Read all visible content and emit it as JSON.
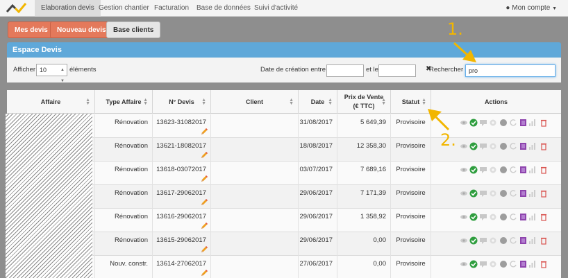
{
  "nav": {
    "items": [
      "Elaboration devis",
      "Gestion chantier",
      "Facturation",
      "Base de données",
      "Suivi d'activité"
    ],
    "account": "Mon compte"
  },
  "buttons": {
    "mes_devis": "Mes devis",
    "nouveau_devis": "Nouveau devis",
    "base_clients": "Base clients"
  },
  "panel": {
    "title": "Espace Devis"
  },
  "filters": {
    "afficher": "Afficher",
    "count_value": "10",
    "elements": "éléments",
    "date_label": "Date de création entre le",
    "et_le": "et le",
    "rechercher": "Rechercher :",
    "search_value": "pro"
  },
  "table": {
    "headers": {
      "affaire": "Affaire",
      "type": "Type Affaire",
      "num": "N° Devis",
      "client": "Client",
      "date": "Date",
      "prix_line1": "Prix de Vente",
      "prix_line2": "(€ TTC)",
      "statut": "Statut",
      "actions": "Actions"
    },
    "rows": [
      {
        "type": "Rénovation",
        "num": "13623-31082017",
        "date": "31/08/2017",
        "prix": "5 649,39",
        "statut": "Provisoire"
      },
      {
        "type": "Rénovation",
        "num": "13621-18082017",
        "date": "18/08/2017",
        "prix": "12 358,30",
        "statut": "Provisoire"
      },
      {
        "type": "Rénovation",
        "num": "13618-03072017",
        "date": "03/07/2017",
        "prix": "7 689,16",
        "statut": "Provisoire"
      },
      {
        "type": "Rénovation",
        "num": "13617-29062017",
        "date": "29/06/2017",
        "prix": "7 171,39",
        "statut": "Provisoire"
      },
      {
        "type": "Rénovation",
        "num": "13616-29062017",
        "date": "29/06/2017",
        "prix": "1 358,92",
        "statut": "Provisoire"
      },
      {
        "type": "Rénovation",
        "num": "13615-29062017",
        "date": "29/06/2017",
        "prix": "0,00",
        "statut": "Provisoire"
      },
      {
        "type": "Nouv. constr.",
        "num": "13614-27062017",
        "date": "27/06/2017",
        "prix": "0,00",
        "statut": "Provisoire"
      }
    ]
  },
  "annotations": {
    "one": "1.",
    "two": "2."
  },
  "colors": {
    "accent_orange": "#e4795b",
    "panel_blue": "#5fa8d9",
    "annotation_yellow": "#f2b600"
  },
  "action_icons": [
    "eye-icon",
    "check-icon",
    "comment-icon",
    "gear-icon",
    "circle-icon",
    "refresh-icon",
    "document-icon",
    "bar-chart-icon",
    "trash-icon"
  ]
}
